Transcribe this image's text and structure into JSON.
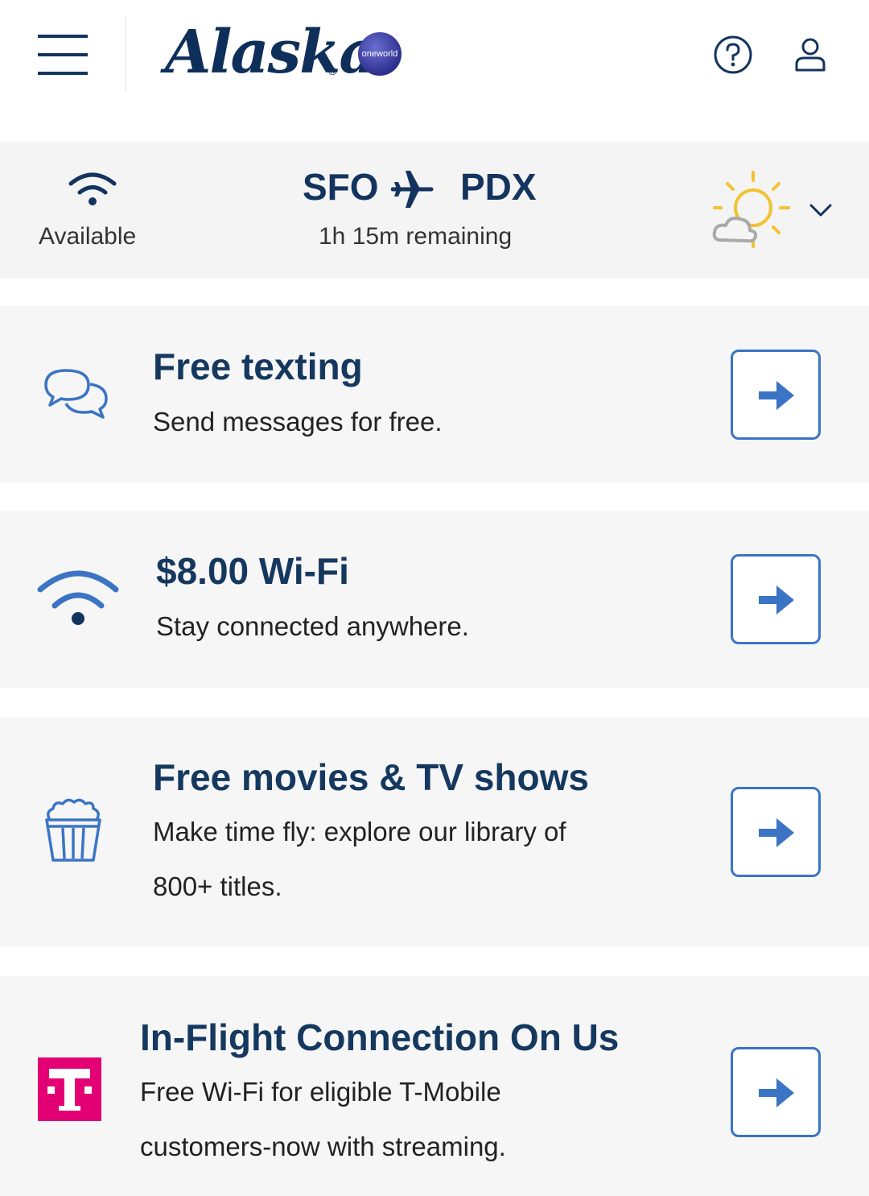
{
  "header": {
    "brand": "Alaska",
    "brand_registered": "®",
    "alliance": "oneworld",
    "icons": {
      "menu": "menu-icon",
      "help": "help-icon",
      "account": "account-icon"
    }
  },
  "flight": {
    "wifi_status": "Available",
    "origin": "SFO",
    "destination": "PDX",
    "remaining": "1h 15m remaining"
  },
  "cards": [
    {
      "title": "Free texting",
      "subtitle": "Send messages for free.",
      "icon": "chat-bubbles-icon"
    },
    {
      "title": "$8.00 Wi-Fi",
      "subtitle": "Stay connected anywhere.",
      "icon": "wifi-icon"
    },
    {
      "title": "Free movies & TV shows",
      "subtitle_line1": "Make time fly: explore our library of",
      "subtitle_line2": "800+ titles.",
      "icon": "popcorn-icon"
    },
    {
      "title": "In-Flight Connection On Us",
      "subtitle_line1": "Free Wi-Fi for eligible T-Mobile",
      "subtitle_line2": "customers-now with streaming.",
      "icon": "t-mobile-logo-icon"
    }
  ],
  "colors": {
    "navy": "#13345e",
    "accent_blue": "#3b74c5",
    "t_mobile_magenta": "#e20074",
    "weather_yellow": "#f2c230"
  }
}
